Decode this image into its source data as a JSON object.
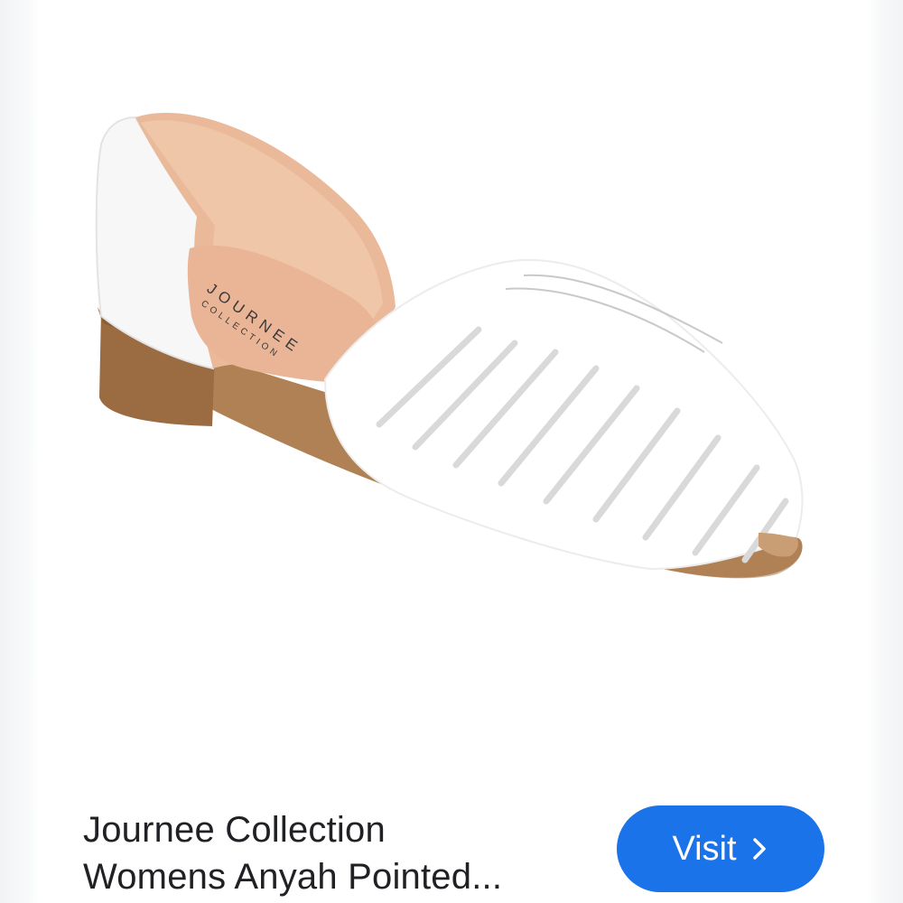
{
  "product": {
    "image_alt": "white woven pointed-toe flat shoe",
    "brand_print_line1": "JOURNEE",
    "brand_print_line2": "COLLECTION",
    "title_line1": "Journee Collection",
    "title_line2": "Womens Anyah Pointed..."
  },
  "actions": {
    "visit_label": "Visit",
    "visit_icon": "chevron-right-icon"
  },
  "colors": {
    "button": "#1a73e8",
    "button_text": "#ffffff",
    "title_text": "#202124"
  }
}
